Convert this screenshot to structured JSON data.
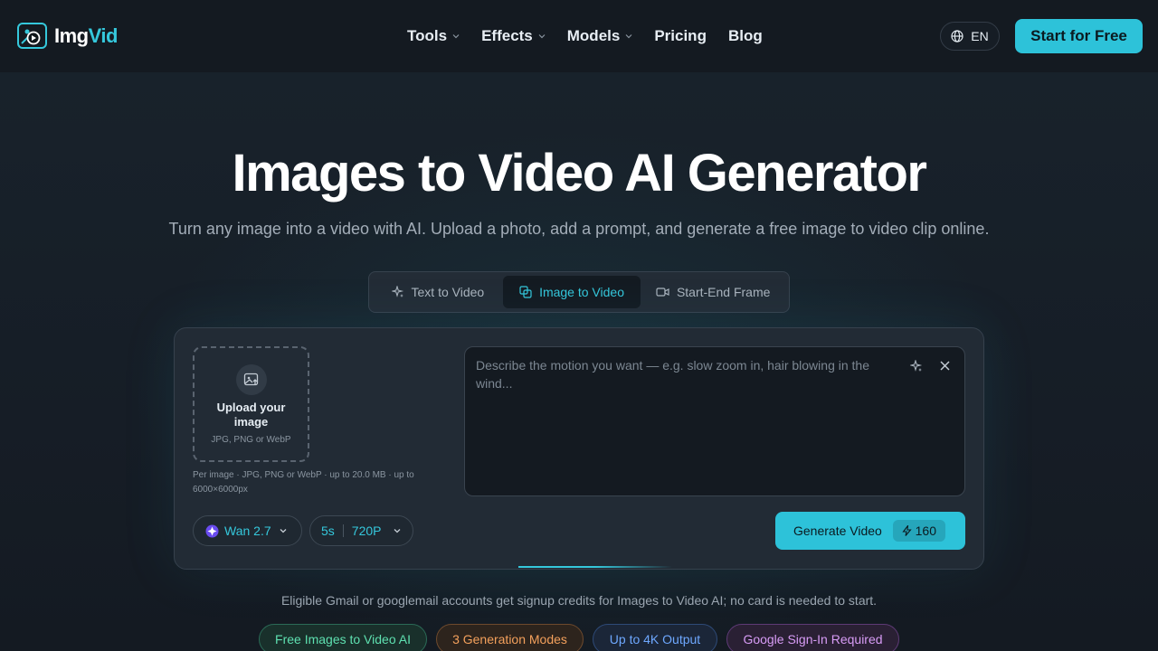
{
  "brand": {
    "name_main": "Img",
    "name_accent": "Vid",
    "accent_color": "#35c8dc"
  },
  "nav": {
    "items": [
      {
        "label": "Tools",
        "has_dropdown": true
      },
      {
        "label": "Effects",
        "has_dropdown": true
      },
      {
        "label": "Models",
        "has_dropdown": true
      },
      {
        "label": "Pricing",
        "has_dropdown": false
      },
      {
        "label": "Blog",
        "has_dropdown": false
      }
    ],
    "language": "EN",
    "cta_label": "Start for Free"
  },
  "hero": {
    "title": "Images to Video AI Generator",
    "subtitle": "Turn any image into a video with AI. Upload a photo, add a prompt, and generate a free image to video clip online."
  },
  "mode_tabs": {
    "items": [
      {
        "label": "Text to Video",
        "icon": "sparkle-icon"
      },
      {
        "label": "Image to Video",
        "icon": "image-copy-icon",
        "active": true
      },
      {
        "label": "Start-End Frame",
        "icon": "video-camera-icon"
      }
    ]
  },
  "generator": {
    "upload_title": "Upload your image",
    "upload_hint": "JPG, PNG or WebP",
    "upload_limits": "Per image · JPG, PNG or WebP · up to 20.0 MB · up to 6000×6000px",
    "prompt_placeholder": "Describe the motion you want — e.g. slow zoom in, hair blowing in the wind...",
    "prompt_value": "",
    "model_label": "Wan 2.7",
    "duration": "5s",
    "resolution": "720P",
    "generate_label": "Generate Video",
    "credits": "160"
  },
  "note": "Eligible Gmail or googlemail accounts get signup credits for Images to Video AI; no card is needed to start.",
  "badges": [
    {
      "label": "Free Images to Video AI",
      "color": "#5ee0b0"
    },
    {
      "label": "3 Generation Modes",
      "color": "#f3a05c"
    },
    {
      "label": "Up to 4K Output",
      "color": "#6ea8ff"
    },
    {
      "label": "Google Sign-In Required",
      "color": "#d89cf6"
    }
  ]
}
